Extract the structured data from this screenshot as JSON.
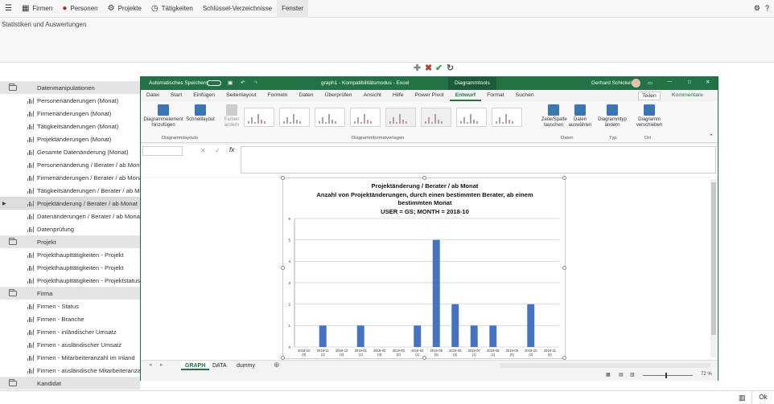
{
  "menu": {
    "items": [
      {
        "icon": "list-icon",
        "label": ""
      },
      {
        "icon": "building-icon",
        "label": "Firmen"
      },
      {
        "icon": "person-icon",
        "label": "Personen"
      },
      {
        "icon": "project-icon",
        "label": "Projekte"
      },
      {
        "icon": "activity-icon",
        "label": "Tätigkeiten"
      },
      {
        "icon": "",
        "label": "Schlüssel-Verzeichnisse"
      },
      {
        "icon": "",
        "label": "Fenster"
      }
    ]
  },
  "ribbon_host": {
    "label": "Statistiken und Auswertungen"
  },
  "tree": [
    {
      "type": "group",
      "label": "Datenmanipulationen"
    },
    {
      "type": "item",
      "label": "Personenänderungen (Monat)"
    },
    {
      "type": "item",
      "label": "Firmenänderungen (Monat)"
    },
    {
      "type": "item",
      "label": "Tätigkeitsänderungen (Monat)"
    },
    {
      "type": "item",
      "label": "Projektänderungen (Monat)"
    },
    {
      "type": "item",
      "label": "Gesamte Datenänderung (Monat)"
    },
    {
      "type": "item",
      "label": "Personenänderung / Berater / ab Monat"
    },
    {
      "type": "item",
      "label": "Firmenänderungen / Berater / ab Monat"
    },
    {
      "type": "item",
      "label": "Tätigkeitsänderungen / Berater / ab Monat"
    },
    {
      "type": "item",
      "label": "Projektänderung / Berater / ab Monat",
      "selected": true
    },
    {
      "type": "item",
      "label": "Datenänderungen / Berater / ab Monat"
    },
    {
      "type": "item",
      "label": "Datenprüfung"
    },
    {
      "type": "group",
      "label": "Projekt"
    },
    {
      "type": "item",
      "label": "Projekthaupttätigkeiten - Projekt"
    },
    {
      "type": "item",
      "label": "Projekthaupttätigkeiten - Projekt"
    },
    {
      "type": "item",
      "label": "Projekthaupttätigkeiten - Projektstatus"
    },
    {
      "type": "group",
      "label": "Firma"
    },
    {
      "type": "item",
      "label": "Firmen - Status"
    },
    {
      "type": "item",
      "label": "Firmen - Branche"
    },
    {
      "type": "item",
      "label": "Firmen - inländischer Umsatz"
    },
    {
      "type": "item",
      "label": "Firmen - ausländischer Umsatz"
    },
    {
      "type": "item",
      "label": "Firmen - Mitarbeiteranzahl im Inland"
    },
    {
      "type": "item",
      "label": "Firmen - ausländische Mitarbeiteranzahl"
    },
    {
      "type": "group",
      "label": "Kandidat"
    }
  ],
  "excel": {
    "autosave": "Automatisches Speichern",
    "doc_title": "graph1 - Kompatibilitätsmodus - Excel",
    "context_tab": "Diagrammtools",
    "user": "Gerhard Schickel",
    "tabs": [
      "Datei",
      "Start",
      "Einfügen",
      "Seitenlayout",
      "Formeln",
      "Daten",
      "Überprüfen",
      "Ansicht",
      "Hilfe",
      "Power Pivot",
      "Entwurf",
      "Format",
      "Suchen"
    ],
    "active_tab": "Entwurf",
    "share": "Teilen",
    "comments": "Kommentare",
    "ribbon": {
      "add_element": "Diagrammelement hinzufügen",
      "quick_layout": "Schnelllayout",
      "colors": "Farben ändern",
      "group_layouts": "Diagrammlayouts",
      "group_styles": "Diagrammformatvorlagen",
      "switch": "Zeile/Spalte tauschen",
      "select_data": "Daten auswählen",
      "group_data": "Daten",
      "change_type": "Diagrammtyp ändern",
      "group_type": "Typ",
      "move": "Diagramm verschieben",
      "group_location": "Ort"
    },
    "fx": "fx",
    "sheets": [
      "GRAPH",
      "DATA",
      "dummy"
    ],
    "active_sheet": "GRAPH",
    "zoom": "72 %"
  },
  "chart_data": {
    "type": "bar",
    "title": [
      "Projektänderung / Berater / ab Monat",
      "Anzahl von Projektänderungen, durch einen bestimmten Berater, ab einem",
      "bestimmten Monat",
      "USER = GS; MONTH = 2018-10"
    ],
    "categories": [
      "2018-10\n(0)",
      "2018-11\n(1)",
      "2018-12\n(0)",
      "2019-01\n(1)",
      "2019-02\n(0)",
      "2019-03\n(0)",
      "2019-04\n(1)",
      "2019-05\n(5)",
      "2019-06\n(2)",
      "2019-07\n(1)",
      "2019-08\n(1)",
      "2019-09\n(0)",
      "2019-10\n(2)",
      "2019-11\n(0)"
    ],
    "values": [
      0,
      1,
      0,
      1,
      0,
      0,
      1,
      5,
      2,
      1,
      1,
      0,
      2,
      0
    ],
    "ylim": [
      0,
      6
    ],
    "yticks": [
      "0",
      "1",
      "2",
      "3",
      "4",
      "5",
      "6"
    ],
    "grid": true,
    "color": "#4472c4"
  },
  "bottom": {
    "ok": "Ok"
  }
}
